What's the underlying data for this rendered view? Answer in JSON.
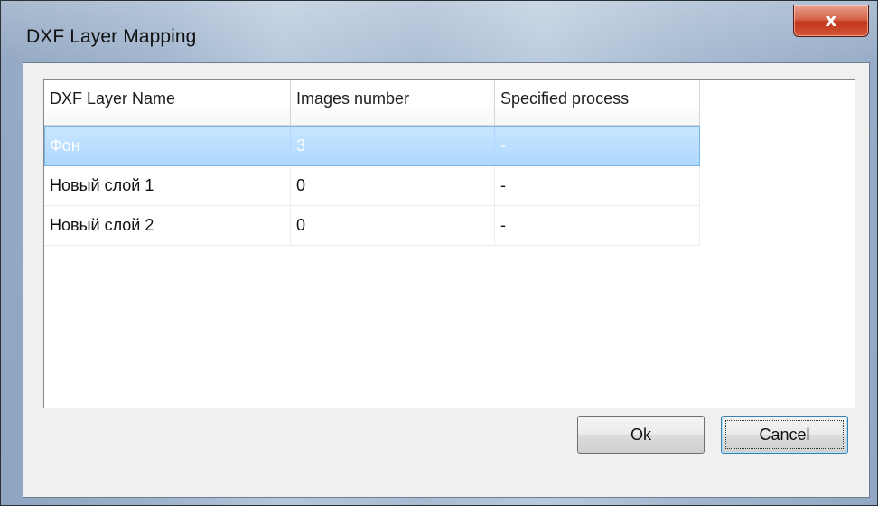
{
  "window": {
    "title": "DXF Layer Mapping",
    "close_label": "x"
  },
  "table": {
    "columns": [
      "DXF Layer Name",
      "Images number",
      "Specified process"
    ],
    "rows": [
      {
        "name": "Фон",
        "images": "3",
        "process": "-",
        "selected": true
      },
      {
        "name": "Новый слой 1",
        "images": "0",
        "process": "-",
        "selected": false
      },
      {
        "name": "Новый слой 2",
        "images": "0",
        "process": "-",
        "selected": false
      }
    ]
  },
  "buttons": {
    "ok_label": "Ok",
    "cancel_label": "Cancel"
  },
  "colors": {
    "selection": "#aed8ff",
    "close_button": "#c2361a"
  }
}
